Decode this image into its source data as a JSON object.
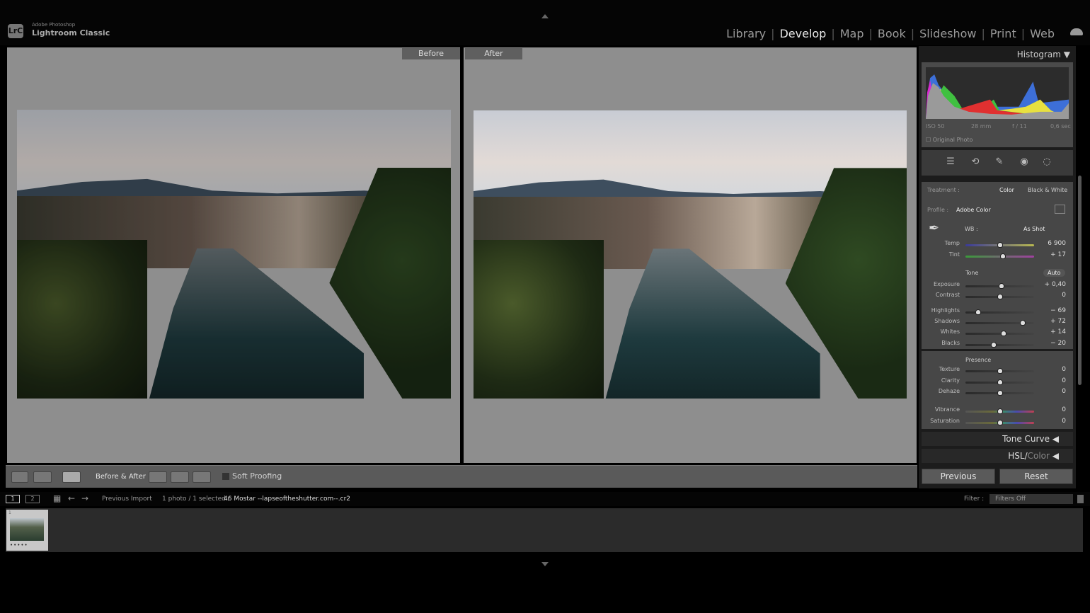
{
  "app": {
    "brand_small": "Adobe Photoshop",
    "brand": "Lightroom Classic",
    "logo": "LrC"
  },
  "modules": [
    {
      "label": "Library",
      "active": false
    },
    {
      "label": "Develop",
      "active": true
    },
    {
      "label": "Map",
      "active": false
    },
    {
      "label": "Book",
      "active": false
    },
    {
      "label": "Slideshow",
      "active": false
    },
    {
      "label": "Print",
      "active": false
    },
    {
      "label": "Web",
      "active": false
    }
  ],
  "view": {
    "before_label": "Before",
    "after_label": "After"
  },
  "toolbar": {
    "before_after_label": "Before & After :",
    "soft_proofing": "Soft Proofing",
    "soft_proofing_checked": false
  },
  "histogram": {
    "title": "Histogram",
    "iso": "ISO 50",
    "focal": "28 mm",
    "aperture": "f / 11",
    "shutter": "0,6 sec",
    "original_photo": "Original Photo"
  },
  "basic": {
    "treatment_label": "Treatment :",
    "treatment_color": "Color",
    "treatment_bw": "Black & White",
    "profile_label": "Profile :",
    "profile_value": "Adobe Color",
    "wb_label": "WB :",
    "wb_value": "As Shot",
    "tone_label": "Tone",
    "auto": "Auto",
    "presence_label": "Presence",
    "sliders": [
      {
        "label": "Temp",
        "value": "6 900",
        "level": 0.5,
        "track": "temp"
      },
      {
        "label": "Tint",
        "value": "+ 17",
        "level": 0.55,
        "track": "tint"
      },
      {
        "label": "Exposure",
        "value": "+ 0,40",
        "level": 0.53
      },
      {
        "label": "Contrast",
        "value": "0",
        "level": 0.5
      },
      {
        "label": "Highlights",
        "value": "− 69",
        "level": 0.19
      },
      {
        "label": "Shadows",
        "value": "+ 72",
        "level": 0.83
      },
      {
        "label": "Whites",
        "value": "+ 14",
        "level": 0.56
      },
      {
        "label": "Blacks",
        "value": "− 20",
        "level": 0.41
      },
      {
        "label": "Texture",
        "value": "0",
        "level": 0.5
      },
      {
        "label": "Clarity",
        "value": "0",
        "level": 0.5
      },
      {
        "label": "Dehaze",
        "value": "0",
        "level": 0.5
      },
      {
        "label": "Vibrance",
        "value": "0",
        "level": 0.5,
        "track": "color"
      },
      {
        "label": "Saturation",
        "value": "0",
        "level": 0.5,
        "track": "color"
      }
    ]
  },
  "panels": {
    "tone_curve": "Tone Curve",
    "hsl": "HSL",
    "hsl_color": "Color"
  },
  "buttons": {
    "previous": "Previous",
    "reset": "Reset"
  },
  "filmstrip": {
    "screen1": "1",
    "screen2": "2",
    "source": "Previous Import",
    "count": "1 photo / 1 selected / ",
    "filename": "46 Mostar --lapseoftheshutter.com--.cr2",
    "filter_label": "Filter :",
    "filter_value": "Filters Off",
    "thumb_index": "1",
    "thumb_stars": "•••••"
  }
}
